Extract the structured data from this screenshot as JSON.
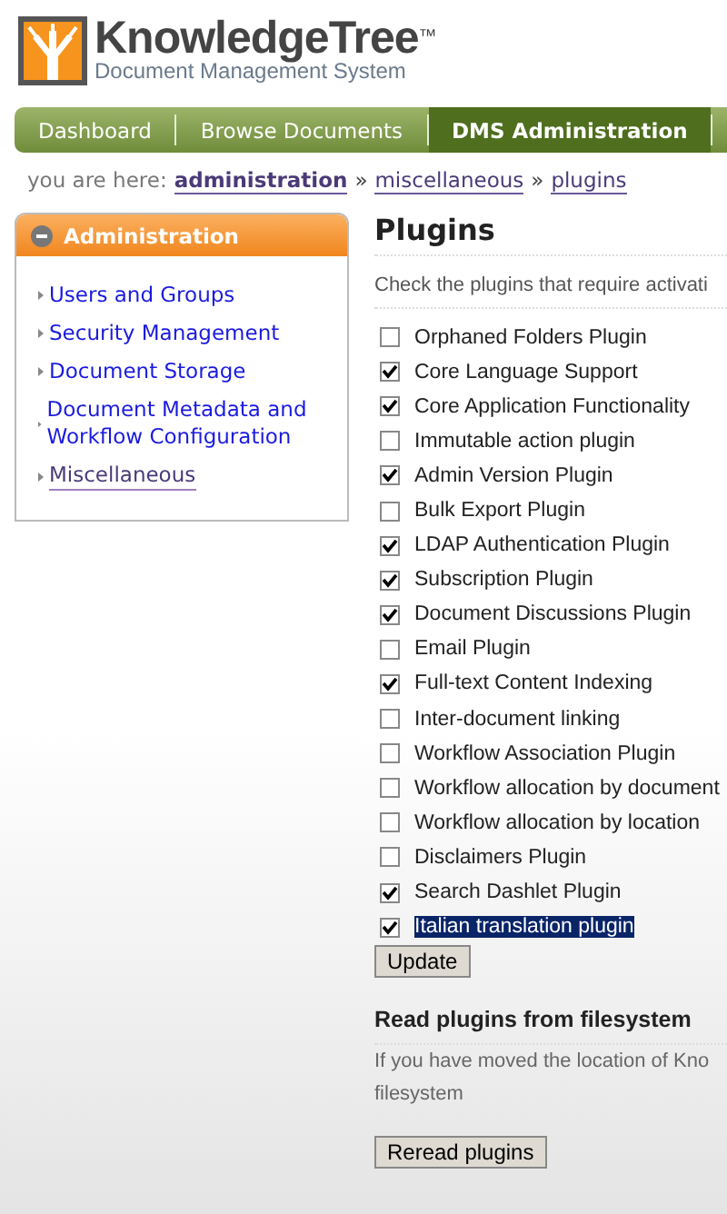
{
  "logo": {
    "name": "KnowledgeTree",
    "trademark": "™",
    "tagline": "Document Management System"
  },
  "nav": [
    {
      "label": "Dashboard",
      "selected": false
    },
    {
      "label": "Browse Documents",
      "selected": false
    },
    {
      "label": "DMS Administration",
      "selected": true
    }
  ],
  "breadcrumb": {
    "prefix": "you are here:",
    "items": [
      {
        "label": "administration",
        "bold": true
      },
      {
        "label": "miscellaneous",
        "bold": false
      },
      {
        "label": "plugins",
        "bold": false
      }
    ],
    "separator": "»"
  },
  "sidebar": {
    "title": "Administration",
    "items": [
      {
        "label": "Users and Groups",
        "selected": false
      },
      {
        "label": "Security Management",
        "selected": false
      },
      {
        "label": "Document Storage",
        "selected": false
      },
      {
        "label": "Document Metadata and Workflow Configuration",
        "selected": false
      },
      {
        "label": "Miscellaneous",
        "selected": true
      }
    ]
  },
  "main": {
    "title": "Plugins",
    "intro": "Check the plugins that require activati",
    "plugins": [
      {
        "label": "Orphaned Folders Plugin",
        "checked": false,
        "highlighted": false
      },
      {
        "label": "Core Language Support",
        "checked": true,
        "highlighted": false
      },
      {
        "label": "Core Application Functionality",
        "checked": true,
        "highlighted": false
      },
      {
        "label": "Immutable action plugin",
        "checked": false,
        "highlighted": false
      },
      {
        "label": "Admin Version Plugin",
        "checked": true,
        "highlighted": false
      },
      {
        "label": "Bulk Export Plugin",
        "checked": false,
        "highlighted": false
      },
      {
        "label": "LDAP Authentication Plugin",
        "checked": true,
        "highlighted": false
      },
      {
        "label": "Subscription Plugin",
        "checked": true,
        "highlighted": false
      },
      {
        "label": "Document Discussions Plugin",
        "checked": true,
        "highlighted": false
      },
      {
        "label": "Email Plugin",
        "checked": false,
        "highlighted": false
      },
      {
        "label": "Full-text Content Indexing",
        "checked": true,
        "highlighted": false
      },
      {
        "label": "Inter-document linking",
        "checked": false,
        "highlighted": false
      },
      {
        "label": "Workflow Association Plugin",
        "checked": false,
        "highlighted": false
      },
      {
        "label": "Workflow allocation by document",
        "checked": false,
        "highlighted": false
      },
      {
        "label": "Workflow allocation by location",
        "checked": false,
        "highlighted": false
      },
      {
        "label": "Disclaimers Plugin",
        "checked": false,
        "highlighted": false
      },
      {
        "label": "Search Dashlet Plugin",
        "checked": true,
        "highlighted": false
      },
      {
        "label": "Italian translation plugin",
        "checked": true,
        "highlighted": true
      }
    ],
    "update_button": "Update",
    "reread_title": "Read plugins from filesystem",
    "reread_text": "If you have moved the location of Kno",
    "reread_text_2": "filesystem",
    "reread_button": "Reread plugins"
  }
}
